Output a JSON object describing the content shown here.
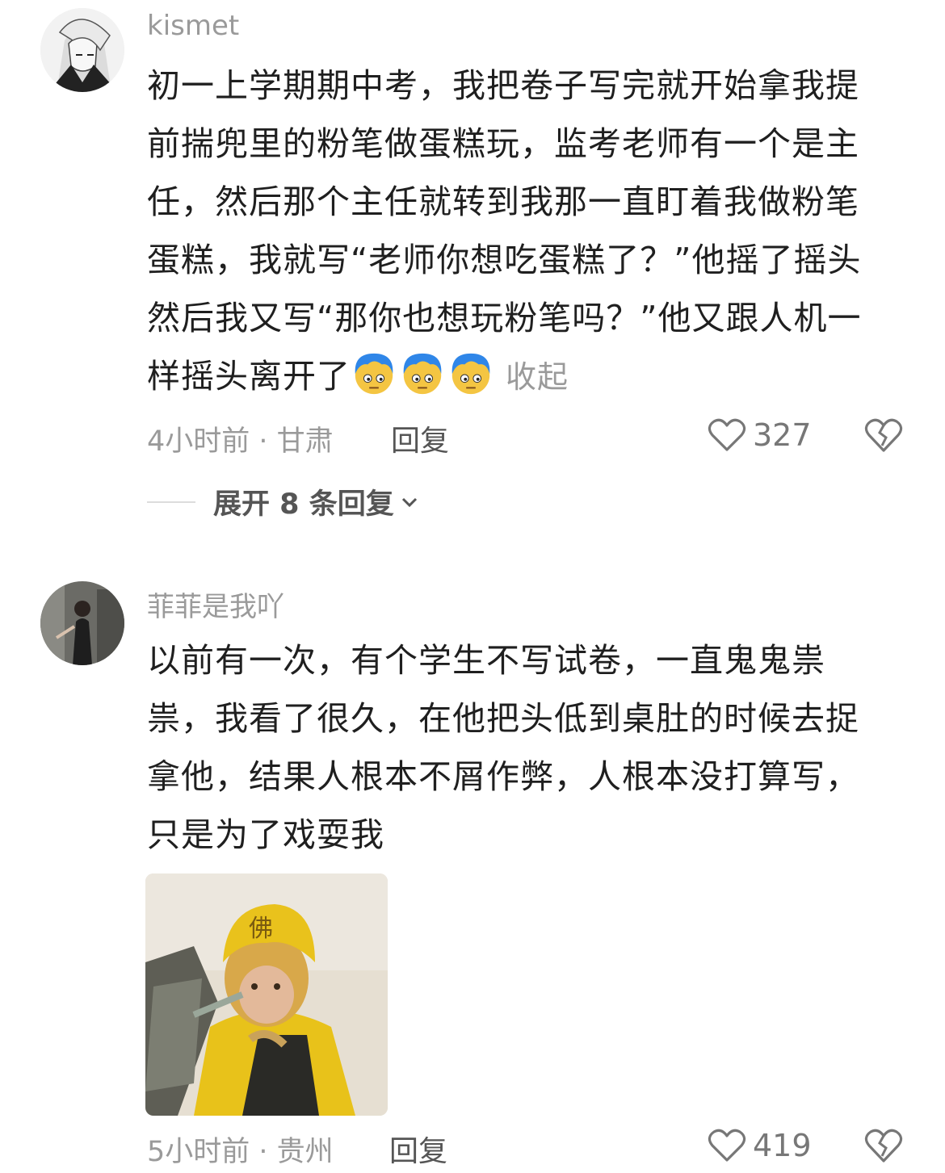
{
  "comments": [
    {
      "username": "kismet",
      "lines": [
        "初一上学期期中考，我把卷子写完就开始拿我提",
        "前揣兜里的粉笔做蛋糕玩，监考老师有一个是主",
        "任，然后那个主任就转到我那一直盯着我做粉笔",
        "蛋糕，我就写“老师你想吃蛋糕了？”他摇了摇头",
        "然后我又写“那你也想玩粉笔吗？”他又跟人机一",
        "样摇头离开了"
      ],
      "emoji_icons": [
        "blue-hair-face-emoji",
        "blue-hair-face-emoji",
        "blue-hair-face-emoji"
      ],
      "collapse_label": "收起",
      "meta": "4小时前 · 甘肃",
      "reply_label": "回复",
      "likes": "327",
      "expand_replies": "展开 8 条回复"
    },
    {
      "username": "菲菲是我吖",
      "lines": [
        "以前有一次，有个学生不写试卷，一直鬼鬼祟",
        "祟，我看了很久，在他把头低到桌肚的时候去捉",
        "拿他，结果人根本不屑作弊，人根本没打算写，",
        "只是为了戏耍我"
      ],
      "sticker": "monkey-king-sticker",
      "meta": "5小时前 · 贵州",
      "reply_label": "回复",
      "likes": "419"
    }
  ],
  "colors": {
    "meta_gray": "#9a9a9a",
    "text": "#1f1f1f",
    "icon_gray": "#777777"
  }
}
